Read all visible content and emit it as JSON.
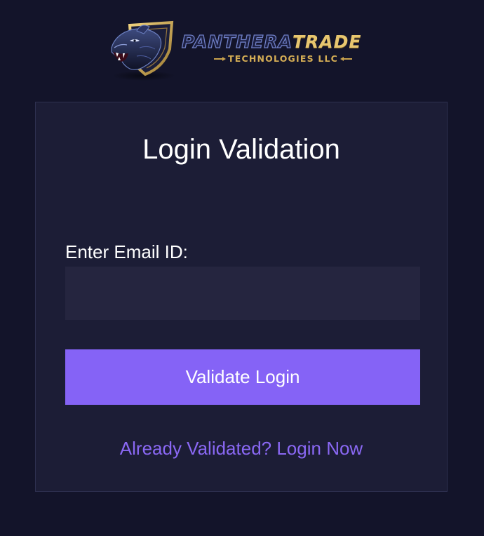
{
  "logo": {
    "brand_part_1": "PANTHERA",
    "brand_part_2": "TRADE",
    "tagline": "TECHNOLOGIES LLC",
    "emblem_icon": "panther-shield-icon"
  },
  "card": {
    "title": "Login Validation",
    "email_label": "Enter Email ID:",
    "email_value": "",
    "email_placeholder": "",
    "validate_button_label": "Validate Login",
    "login_link_label": "Already Validated? Login Now"
  },
  "colors": {
    "page_background": "#13142a",
    "card_background": "#1c1d36",
    "input_background": "#25253f",
    "accent": "#8563f6",
    "link": "#8a68f4",
    "brand_gold": "#e7c66f",
    "brand_blue": "#6f7fc6"
  }
}
